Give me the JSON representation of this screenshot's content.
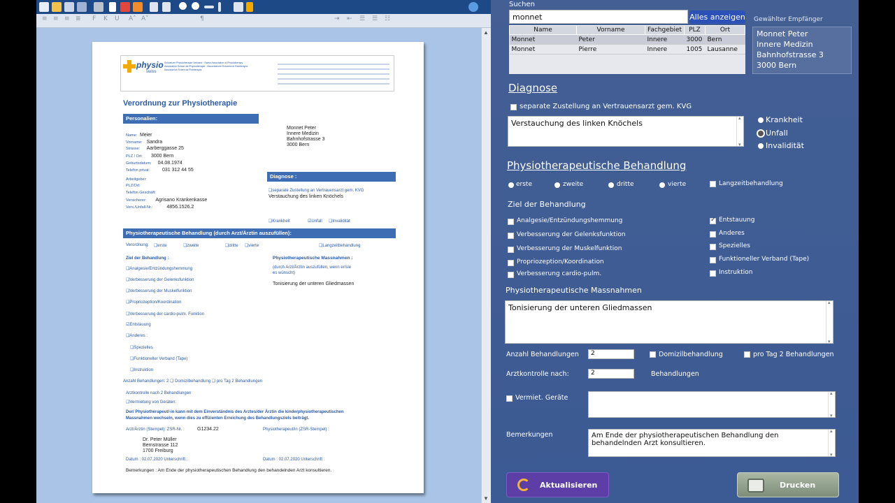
{
  "paper": {
    "org_name": "physio",
    "org_sub": "swiss",
    "org_lines": [
      "Schweizer Physiotherapie Verband · Swiss Association of Physiotherapy",
      "Association Suisse de Physiothérapie · Associazione Svizzera di Fisioterapia",
      "Associaziun Svizra da Fisioterapia"
    ],
    "title": "Verordnung zur Physiotherapie",
    "personalien_header": "Personalien:",
    "fields": [
      {
        "label": "Name:",
        "value": "Meier"
      },
      {
        "label": "Vorname:",
        "value": "Sandra"
      },
      {
        "label": "Strasse:",
        "value": "Aarberggasse 25"
      },
      {
        "label": "PLZ / Ort:",
        "value": "3000 Bern"
      },
      {
        "label": "Geburtsdatum:",
        "value": "04.08.1974"
      },
      {
        "label": "Telefon privat:",
        "value": "031 312 44 55"
      },
      {
        "label": "Arbeitgeber:",
        "value": ""
      },
      {
        "label": "PLZ/Ort:",
        "value": ""
      },
      {
        "label": "Telefon Geschäft:",
        "value": ""
      },
      {
        "label": "Versicherer:",
        "value": "Agrisano Krankenkasse"
      },
      {
        "label": "Vers./Unfall-Nr.:",
        "value": "4856.1526.2"
      }
    ],
    "recipient": [
      "Monnet Peter",
      "Innere Medizin",
      "Bahnhofstrasse 3",
      "3000 Bern"
    ],
    "diagnose_header": "Diagnose :",
    "sep_zustellung": "❑separate Zustellung an Vertrauensarzt gem. KVG",
    "diagnose_text": "Verstauchung des linken Knöchels",
    "krankheit": "❑Krankheit",
    "unfall": "☑Unfall",
    "invaliditaet": "❑Invalidität",
    "behandlung_header": "Physiotherapeutische Behandlung (durch Arzt/Ärztin auszufüllen):",
    "verordnung": "Verordnung:",
    "erste": "❑erste",
    "zweite": "❑zweite",
    "dritte": "❑dritte",
    "vierte": "❑vierte",
    "langzeit": "❑Langzeitbehandlung",
    "ziel_header": "Ziel der Behandlung :",
    "ziele": [
      "❑Analgesie/Entzündungshemmung",
      "❑Verbesserung der Gelenksfunktion",
      "❑Verbesserung der Muskelfunktion",
      "❑Propriozeption/Koordination",
      "❑Verbesserung der cardio-pulm. Funktion",
      "☑Entstauung",
      "❑Anderes :"
    ],
    "ziele_sub": [
      "❑Spezielles",
      "❑Funktioneller Verband (Tape)",
      "❑Instruktion"
    ],
    "massnahmen_header": "Physiotherapeutische Massnahmen :",
    "massnahmen_hint1": "(durch Arzt/Ärztin auszufüllen, wenn er/sie",
    "massnahmen_hint2": "es wünscht)",
    "massnahmen_text": "Tonisierung der unteren Gliedmassen",
    "anzahl": "Anzahl Behandlungen: 2   ❑   Domizilbehandlung   ❑   pro Tag 2 Behandlungen",
    "arztkontrolle": "Arztkontrolle nach 2 Behandlungen",
    "vermietung": "❑Vermietung von Geräten:",
    "note1": "Der/ Physiotherapeut/-in kann mit dem Einverständnis des Arztes/der Ärztin die kinderphysiotherapeutischen",
    "note2": "Massnahmen wechseln, wenn dies zu effizienten Erreichung des Behandlungsziels beiträgt.",
    "arzt_label": "Arzt/Ärztin (Stempel): ZSR-Nr. :",
    "zsr": "G1234.22",
    "physio_label": "Physiotherapeut/in (ZSR-Stempel) :",
    "arzt": [
      "Dr. Peter Müller",
      "Bernstrasse 112",
      "1700 Freiburg"
    ],
    "datum1": "Datum : 02.07.2020      Unterschrift :",
    "datum2": "Datum : 02.07.2020    Unterschrift :",
    "bemerkungen": "Bemerkungen : Am Ende der physiotherapeutischen Behandlung den behandelnden Arzt konsultieren."
  },
  "form": {
    "suchen_label": "Suchen",
    "search_value": "monnet",
    "alles_anzeigen": "Alles anzeigen",
    "gewaehlter_label": "Gewählter Empfänger",
    "columns": [
      "Name",
      "Vorname",
      "Fachgebiet",
      "PLZ",
      "Ort"
    ],
    "rows": [
      [
        "Monnet",
        "Peter",
        "Innere",
        "3000",
        "Bern"
      ],
      [
        "Monnet",
        "Pierre",
        "Innere",
        "1005",
        "Lausanne"
      ]
    ],
    "empfaenger": [
      "Monnet Peter",
      "Innere Medizin",
      "Bahnhofstrasse 3",
      "3000 Bern"
    ],
    "diagnose_title": "Diagnose",
    "separate": "separate Zustellung an Vertrauensarzt gem. KVG",
    "diagnose_text": "Verstauchung des linken Knöchels",
    "krankheit": "Krankheit",
    "unfall": "Unfall",
    "invaliditaet": "Invalidität",
    "behandlung_title": "Physiotherapeutische Behandlung",
    "erste": "erste",
    "zweite": "zweite",
    "dritte": "dritte",
    "vierte": "vierte",
    "langzeit": "Langzeitbehandlung",
    "ziel_label": "Ziel der Behandlung",
    "ziele_left": [
      "Analgesie/Entzündungshemmung",
      "Verbesserung der Gelenksfunktion",
      "Verbesserung der Muskelfunktion",
      "Propriozeption/Koordination",
      "Verbesserung cardio-pulm."
    ],
    "ziele_right": [
      "Entstauung",
      "Anderes",
      "Spezielles",
      "Funktioneller Verband (Tape)",
      "Instruktion"
    ],
    "massnahmen_label": "Physiotherapeutische Massnahmen",
    "massnahmen_text": "Tonisierung der unteren Gliedmassen",
    "anzahl_label": "Anzahl Behandlungen",
    "anzahl_value": "2",
    "domizil": "Domizilbehandlung",
    "pro_tag": "pro Tag 2 Behandlungen",
    "arztkontrolle_label": "Arztkontrolle nach:",
    "arztkontrolle_value": "2",
    "behandlungen": "Behandlungen",
    "vermiet": "Vermiet. Geräte",
    "bemerkungen_label": "Bemerkungen",
    "bemerkungen_text": "Am Ende der physiotherapeutischen Behandlung den behandelnden Arzt konsultieren.",
    "aktualisieren": "Aktualisieren",
    "drucken": "Drucken"
  },
  "toolbar2": [
    "F",
    "K",
    "U",
    "A˄",
    "A˅",
    "¶"
  ]
}
